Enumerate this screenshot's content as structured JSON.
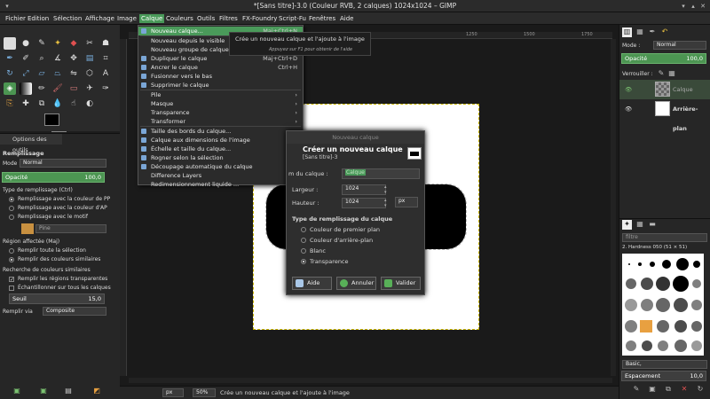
{
  "window": {
    "title": "*[Sans titre]-3.0 (Couleur RVB, 2 calques) 1024x1024 – GIMP"
  },
  "menubar": [
    "Fichier",
    "Edition",
    "Sélection",
    "Affichage",
    "Image",
    "Calque",
    "Couleurs",
    "Outils",
    "Filtres",
    "FX-Foundry",
    "Script-Fu",
    "Fenêtres",
    "Aide"
  ],
  "tool_options": {
    "tab_label": "Options des outils",
    "title": "Remplissage",
    "mode_label": "Mode :",
    "mode_value": "Normal",
    "opacity_label": "Opacité",
    "opacity_value": "100,0",
    "fill_type_label": "Type de remplissage (Ctrl)",
    "fill_types": [
      "Remplissage avec la couleur de PP",
      "Remplissage avec la couleur d'AP",
      "Remplissage avec le motif"
    ],
    "pattern_name": "Pine",
    "region_label": "Région affectée (Maj)",
    "regions": [
      "Remplir toute la sélection",
      "Remplir des couleurs similaires"
    ],
    "similar_label": "Recherche de couleurs similaires",
    "checks": [
      "Remplir les régions transparentes",
      "Échantillonner sur tous les calques"
    ],
    "threshold_label": "Seuil",
    "threshold_value": "15,0",
    "fill_by_label": "Remplir via",
    "fill_by_value": "Composite"
  },
  "layer_menu": {
    "items": [
      {
        "label": "Nouveau calque...",
        "shortcut": "Maj+Ctrl+N",
        "highlight": true
      },
      {
        "label": "Nouveau depuis le visible",
        "shortcut": ""
      },
      {
        "label": "Nouveau groupe de calques...",
        "shortcut": ""
      },
      {
        "label": "Dupliquer le calque",
        "shortcut": "Maj+Ctrl+D"
      },
      {
        "label": "Ancrer le calque",
        "shortcut": "Ctrl+H"
      },
      {
        "label": "Fusionner vers le bas",
        "shortcut": ""
      },
      {
        "label": "Supprimer le calque",
        "shortcut": ""
      },
      {
        "label": "Pile",
        "shortcut": "›"
      },
      {
        "label": "Masque",
        "shortcut": "›"
      },
      {
        "label": "Transparence",
        "shortcut": "›"
      },
      {
        "label": "Transformer",
        "shortcut": "›"
      },
      {
        "label": "Taille des bords du calque...",
        "shortcut": ""
      },
      {
        "label": "Calque aux dimensions de l'image",
        "shortcut": ""
      },
      {
        "label": "Échelle et taille du calque...",
        "shortcut": ""
      },
      {
        "label": "Rogner selon la sélection",
        "shortcut": ""
      },
      {
        "label": "Découpage automatique du calque",
        "shortcut": ""
      },
      {
        "label": "Difference Layers",
        "shortcut": ""
      },
      {
        "label": "Redimensionnement liquide ...",
        "shortcut": ""
      }
    ]
  },
  "tooltip": {
    "main": "Crée un nouveau calque et l'ajoute à l'image",
    "hint": "Appuyez sur F1 pour obtenir de l'aide"
  },
  "dialog": {
    "window_title": "Nouveau calque",
    "heading": "Créer un nouveau calque",
    "subheading": "[Sans titre]-3",
    "name_label": "m du calque :",
    "name_value": "Calque",
    "width_label": "Largeur :",
    "width_value": "1024",
    "height_label": "Hauteur :",
    "height_value": "1024",
    "unit": "px",
    "fill_label": "Type de remplissage du calque",
    "fill_options": [
      "Couleur de premier plan",
      "Couleur d'arrière-plan",
      "Blanc",
      "Transparence"
    ],
    "selected_fill": 3,
    "buttons": {
      "help": "Aide",
      "cancel": "Annuler",
      "ok": "Valider"
    }
  },
  "right_panel": {
    "mode_label": "Mode :",
    "mode_value": "Normal",
    "opacity_label": "Opacité",
    "opacity_value": "100,0",
    "lock_label": "Verrouiller :",
    "layers": [
      "Calque",
      "Arrière-plan"
    ],
    "brush_filter": "filtre",
    "brush_name": "2. Hardness 050 (51 × 51)",
    "brush_preset": "Basic,",
    "spacing_label": "Espacement",
    "spacing_value": "10,0"
  },
  "status": {
    "unit": "px",
    "zoom": "50%",
    "message": "Crée un nouveau calque et l'ajoute à l'image"
  },
  "rulers": {
    "top": [
      "0",
      "1250",
      "1500",
      "1750"
    ],
    "left": [
      "1",
      "2",
      "5",
      "5",
      "7",
      "2",
      "5",
      "7"
    ]
  },
  "colors": {
    "accent": "#4c9552",
    "highlight": "#4a9a5a"
  }
}
